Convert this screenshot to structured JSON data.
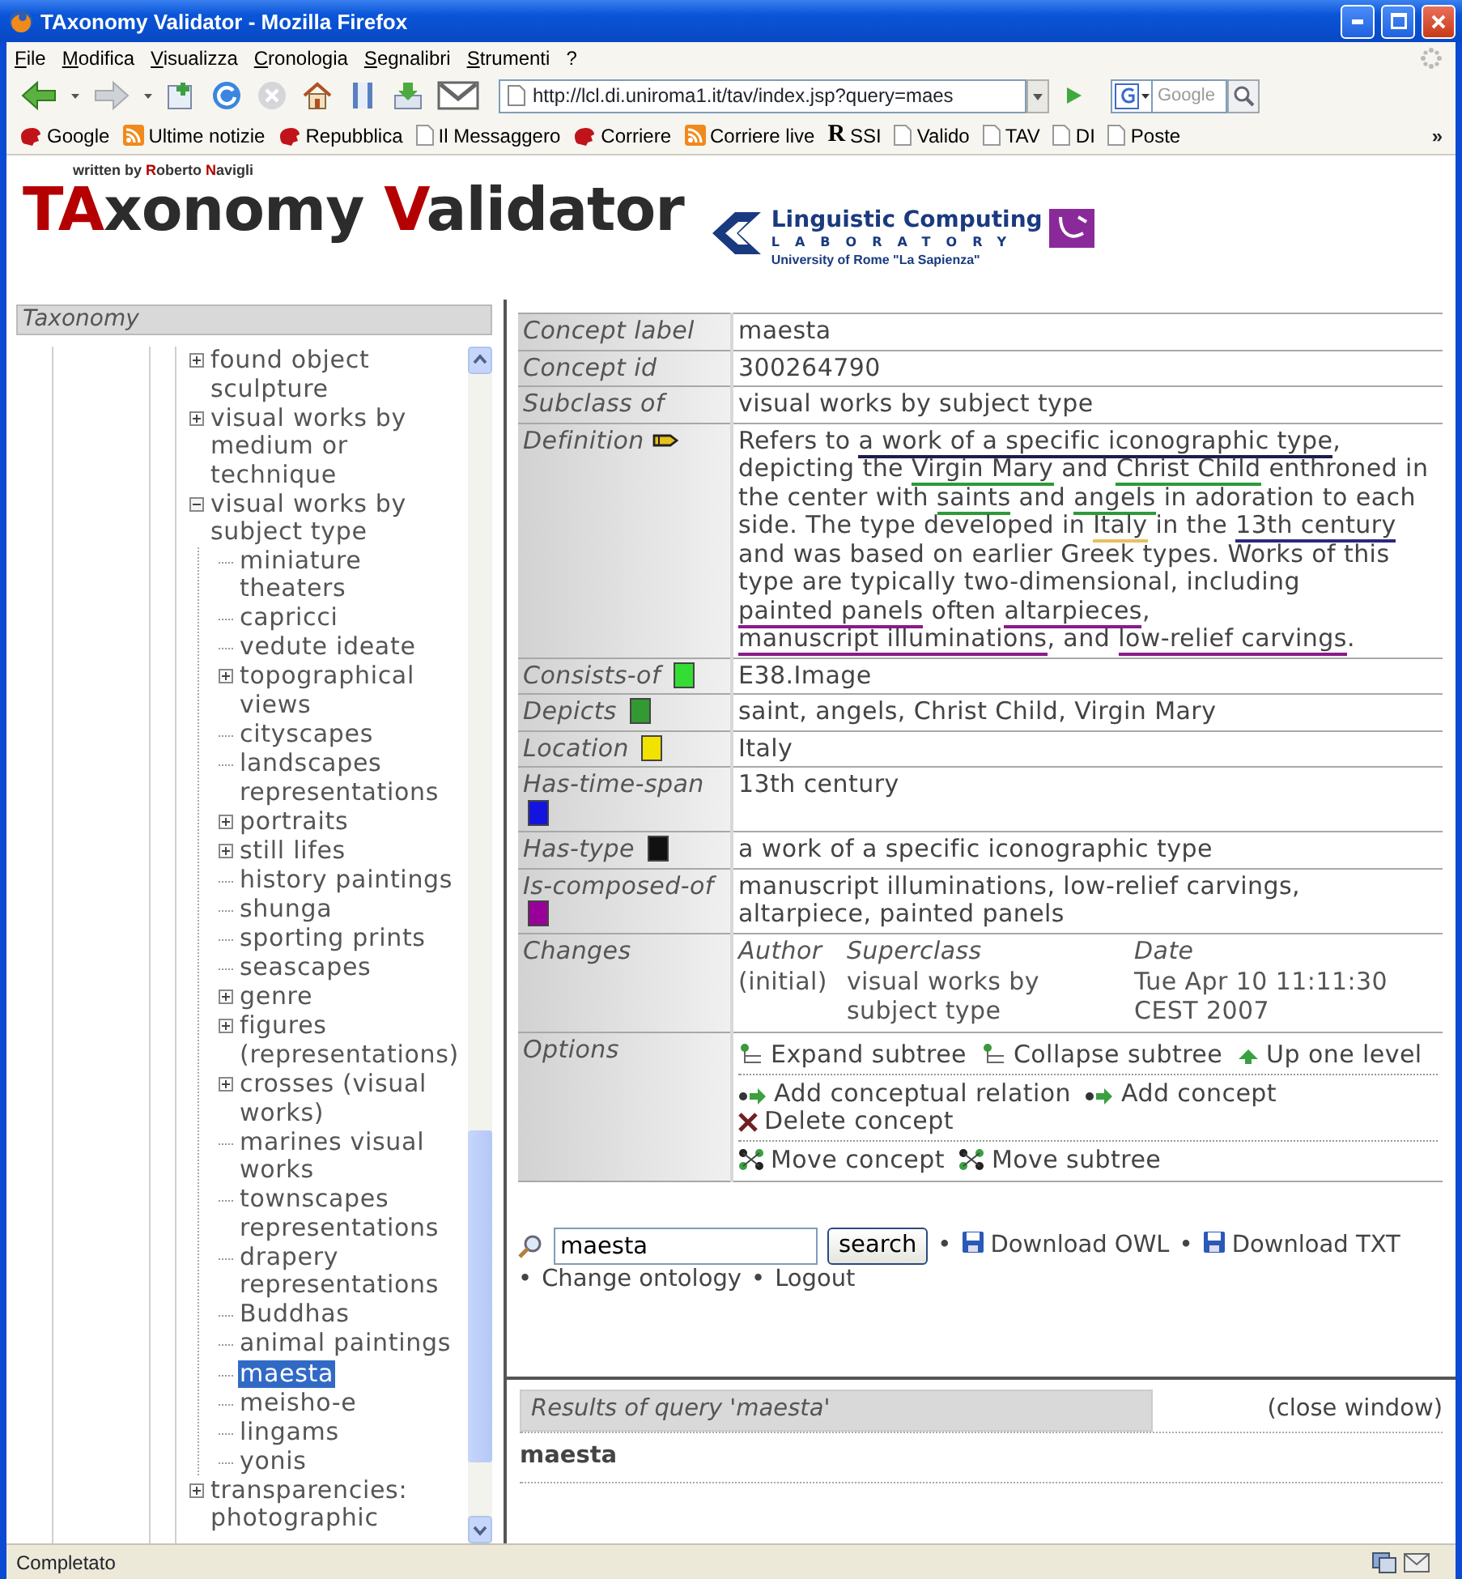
{
  "window": {
    "title": "TAxonomy Validator - Mozilla Firefox"
  },
  "menu": [
    "File",
    "Modifica",
    "Visualizza",
    "Cronologia",
    "Segnalibri",
    "Strumenti",
    "?"
  ],
  "toolbar": {
    "url": "http://lcl.di.uniroma1.it/tav/index.jsp?query=maes",
    "search_placeholder": "Google"
  },
  "bookmarks": [
    {
      "label": "Google",
      "kind": "mascot"
    },
    {
      "label": "Ultime notizie",
      "kind": "rss"
    },
    {
      "label": "Repubblica",
      "kind": "mascot"
    },
    {
      "label": "Il Messaggero",
      "kind": "page"
    },
    {
      "label": "Corriere",
      "kind": "mascot"
    },
    {
      "label": "Corriere live",
      "kind": "rss"
    },
    {
      "label": "SSI",
      "kind": "letter",
      "glyph": "R"
    },
    {
      "label": "Valido",
      "kind": "page"
    },
    {
      "label": "TAV",
      "kind": "page"
    },
    {
      "label": "DI",
      "kind": "page"
    },
    {
      "label": "Poste",
      "kind": "page"
    }
  ],
  "bookmarks_more": "»",
  "header": {
    "byline": [
      {
        "text": "written by ",
        "accent": false
      },
      {
        "text": "R",
        "accent": true
      },
      {
        "text": "oberto ",
        "accent": false
      },
      {
        "text": "N",
        "accent": true
      },
      {
        "text": "avigli",
        "accent": false
      }
    ],
    "logo": [
      {
        "text": "TA",
        "accent": true
      },
      {
        "text": "xonomy ",
        "accent": false
      },
      {
        "text": "V",
        "accent": true
      },
      {
        "text": "alidator",
        "accent": false
      }
    ],
    "lab": {
      "name": "Linguistic Computing",
      "word": "LABORATORY",
      "university": "University of Rome \"La Sapienza\""
    }
  },
  "taxonomy": {
    "title": "Taxonomy",
    "tree": [
      {
        "label": "found object sculpture",
        "expandable": true,
        "expanded": false,
        "selected": false
      },
      {
        "label": "visual works by medium or technique",
        "expandable": true,
        "expanded": false,
        "selected": false
      },
      {
        "label": "visual works by subject type",
        "expandable": true,
        "expanded": true,
        "selected": false,
        "children": [
          {
            "label": "miniature theaters",
            "expandable": false,
            "selected": false
          },
          {
            "label": "capricci",
            "expandable": false,
            "selected": false
          },
          {
            "label": "vedute ideate",
            "expandable": false,
            "selected": false
          },
          {
            "label": "topographical views",
            "expandable": true,
            "expanded": false,
            "selected": false
          },
          {
            "label": "cityscapes",
            "expandable": false,
            "selected": false
          },
          {
            "label": "landscapes representations",
            "expandable": false,
            "selected": false
          },
          {
            "label": "portraits",
            "expandable": true,
            "expanded": false,
            "selected": false
          },
          {
            "label": "still lifes",
            "expandable": true,
            "expanded": false,
            "selected": false
          },
          {
            "label": "history paintings",
            "expandable": false,
            "selected": false
          },
          {
            "label": "shunga",
            "expandable": false,
            "selected": false
          },
          {
            "label": "sporting prints",
            "expandable": false,
            "selected": false
          },
          {
            "label": "seascapes",
            "expandable": false,
            "selected": false
          },
          {
            "label": "genre",
            "expandable": true,
            "expanded": false,
            "selected": false
          },
          {
            "label": "figures (representations)",
            "expandable": true,
            "expanded": false,
            "selected": false
          },
          {
            "label": "crosses (visual works)",
            "expandable": true,
            "expanded": false,
            "selected": false
          },
          {
            "label": "marines visual works",
            "expandable": false,
            "selected": false
          },
          {
            "label": "townscapes representations",
            "expandable": false,
            "selected": false
          },
          {
            "label": "drapery representations",
            "expandable": false,
            "selected": false
          },
          {
            "label": "Buddhas",
            "expandable": false,
            "selected": false
          },
          {
            "label": "animal paintings",
            "expandable": false,
            "selected": false
          },
          {
            "label": "maesta",
            "expandable": false,
            "selected": true
          },
          {
            "label": "meisho-e",
            "expandable": false,
            "selected": false
          },
          {
            "label": "lingams",
            "expandable": false,
            "selected": false
          },
          {
            "label": "yonis",
            "expandable": false,
            "selected": false
          }
        ]
      },
      {
        "label": "transparencies: photographic",
        "expandable": true,
        "expanded": false,
        "selected": false
      }
    ]
  },
  "concept": {
    "rows": [
      {
        "kind": "text",
        "label": "Concept label",
        "value": "maesta"
      },
      {
        "kind": "text",
        "label": "Concept id",
        "value": "300264790"
      },
      {
        "kind": "text",
        "label": "Subclass of",
        "value": "visual works by subject type"
      },
      {
        "kind": "definition",
        "label": "Definition",
        "segments": [
          {
            "text": "Refers to "
          },
          {
            "text": "a work of a specific iconographic type",
            "color": "#1c1c50"
          },
          {
            "text": ", depicting the "
          },
          {
            "text": "Virgin Mary",
            "color": "#2e9a3a"
          },
          {
            "text": " and "
          },
          {
            "text": "Christ Child",
            "color": "#2e9a3a"
          },
          {
            "text": " enthroned in the center with "
          },
          {
            "text": "saints",
            "color": "#2e9a3a"
          },
          {
            "text": " and "
          },
          {
            "text": "angels",
            "color": "#2e9a3a"
          },
          {
            "text": " in adoration to each side. The type developed in "
          },
          {
            "text": "Italy",
            "color": "#e8c060"
          },
          {
            "text": " in the "
          },
          {
            "text": "13th century",
            "color": "#2a2a80"
          },
          {
            "text": " and was based on earlier Greek types. Works of this type are typically two-dimensional, including "
          },
          {
            "text": "painted panels",
            "color": "#8a1a8a"
          },
          {
            "text": " often "
          },
          {
            "text": "altarpieces",
            "color": "#8a1a8a"
          },
          {
            "text": ", "
          },
          {
            "text": "manuscript illuminations",
            "color": "#8a1a8a"
          },
          {
            "text": ", and "
          },
          {
            "text": "low-relief carvings",
            "color": "#8a1a8a"
          },
          {
            "text": "."
          }
        ]
      },
      {
        "kind": "relation",
        "label": "Consists-of",
        "color": "#33dd33",
        "value": "E38.Image"
      },
      {
        "kind": "relation",
        "label": "Depicts",
        "color": "#339933",
        "value": "saint, angels, Christ Child, Virgin Mary"
      },
      {
        "kind": "relation",
        "label": "Location",
        "color": "#f2e200",
        "value": "Italy"
      },
      {
        "kind": "relation",
        "label": "Has-time-span",
        "color": "#1414e0",
        "value": "13th century"
      },
      {
        "kind": "relation",
        "label": "Has-type",
        "color": "#111111",
        "value": "a work of a specific iconographic type"
      },
      {
        "kind": "relation",
        "label": "Is-composed-of",
        "color": "#990099",
        "value": "manuscript illuminations, low-relief carvings, altarpiece, painted panels"
      },
      {
        "kind": "changes",
        "label": "Changes",
        "columns": [
          "Author",
          "Superclass",
          "Date"
        ],
        "values": [
          "(initial)",
          "visual works by subject type",
          "Tue Apr 10 11:11:30 CEST 2007"
        ]
      },
      {
        "kind": "options",
        "label": "Options",
        "lines": [
          [
            {
              "kind": "expand",
              "label": "Expand subtree"
            },
            {
              "kind": "collapse",
              "label": "Collapse subtree"
            },
            {
              "kind": "up",
              "label": "Up one level"
            }
          ],
          [
            {
              "kind": "add",
              "label": "Add conceptual relation"
            },
            {
              "kind": "add",
              "label": "Add concept"
            },
            {
              "kind": "delete",
              "label": "Delete concept"
            }
          ],
          [
            {
              "kind": "move",
              "label": "Move concept"
            },
            {
              "kind": "move",
              "label": "Move subtree"
            }
          ]
        ]
      }
    ]
  },
  "search": {
    "query": "maesta",
    "button": "search",
    "links": [
      {
        "bullet": "•",
        "label": "Download OWL",
        "kind": "download"
      },
      {
        "bullet": "•",
        "label": "Download TXT",
        "kind": "download"
      },
      {
        "bullet": "•",
        "label": "Change ontology",
        "kind": "plain"
      },
      {
        "bullet": "•",
        "label": "Logout",
        "kind": "plain"
      }
    ]
  },
  "results": {
    "title": "Results of query 'maesta'",
    "close": "(close window)",
    "items": [
      "maesta"
    ]
  },
  "status_bar": {
    "text": "Completato"
  }
}
